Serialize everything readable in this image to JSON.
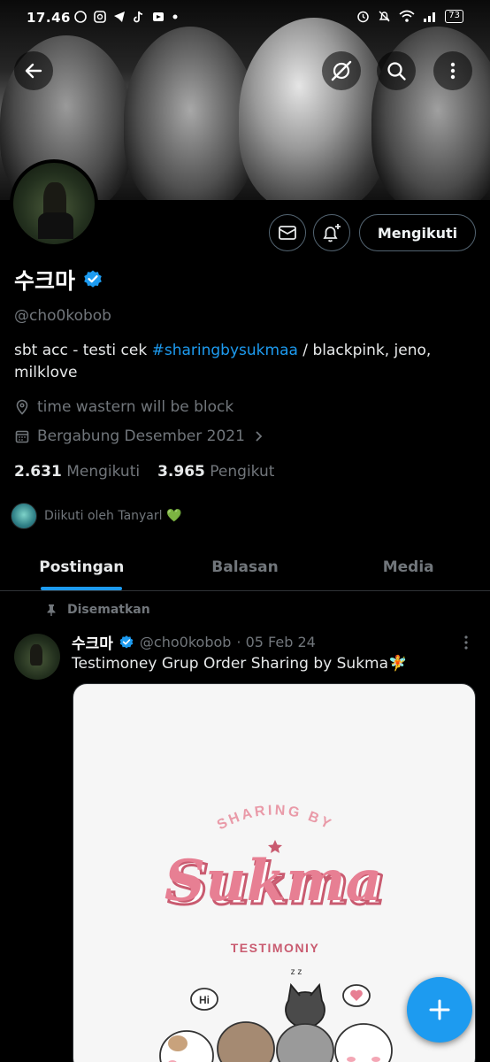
{
  "status_bar": {
    "time": "17.46",
    "battery": "73"
  },
  "profile": {
    "display_name": "수크마",
    "handle": "@cho0kobob",
    "bio_prefix": "sbt acc - testi cek ",
    "bio_hashtag": "#sharingbysukmaa",
    "bio_suffix": " / blackpink, jeno, milklove",
    "location": "time wastern will be block",
    "joined": "Bergabung Desember 2021",
    "following_count": "2.631",
    "following_label": "Mengikuti",
    "followers_count": "3.965",
    "followers_label": "Pengikut",
    "followed_by": "Diikuti oleh Tanyarl 💚",
    "follow_button": "Mengikuti"
  },
  "tabs": [
    {
      "label": "Postingan",
      "active": true
    },
    {
      "label": "Balasan",
      "active": false
    },
    {
      "label": "Media",
      "active": false
    }
  ],
  "pinned_post": {
    "pinned_label": "Disematkan",
    "author_name": "수크마",
    "author_handle": "@cho0kobob",
    "date": "· 05 Feb 24",
    "text": "Testimoney Grup Order Sharing by Sukma🧚",
    "media": {
      "top_text": "SHARING BY",
      "main_text": "Sukma",
      "sub_text": "TESTIMONIY",
      "bubble_1": "Hi",
      "bubble_2": "z z"
    }
  },
  "colors": {
    "accent": "#1d9bf0",
    "brand_pink": "#e77f93"
  }
}
